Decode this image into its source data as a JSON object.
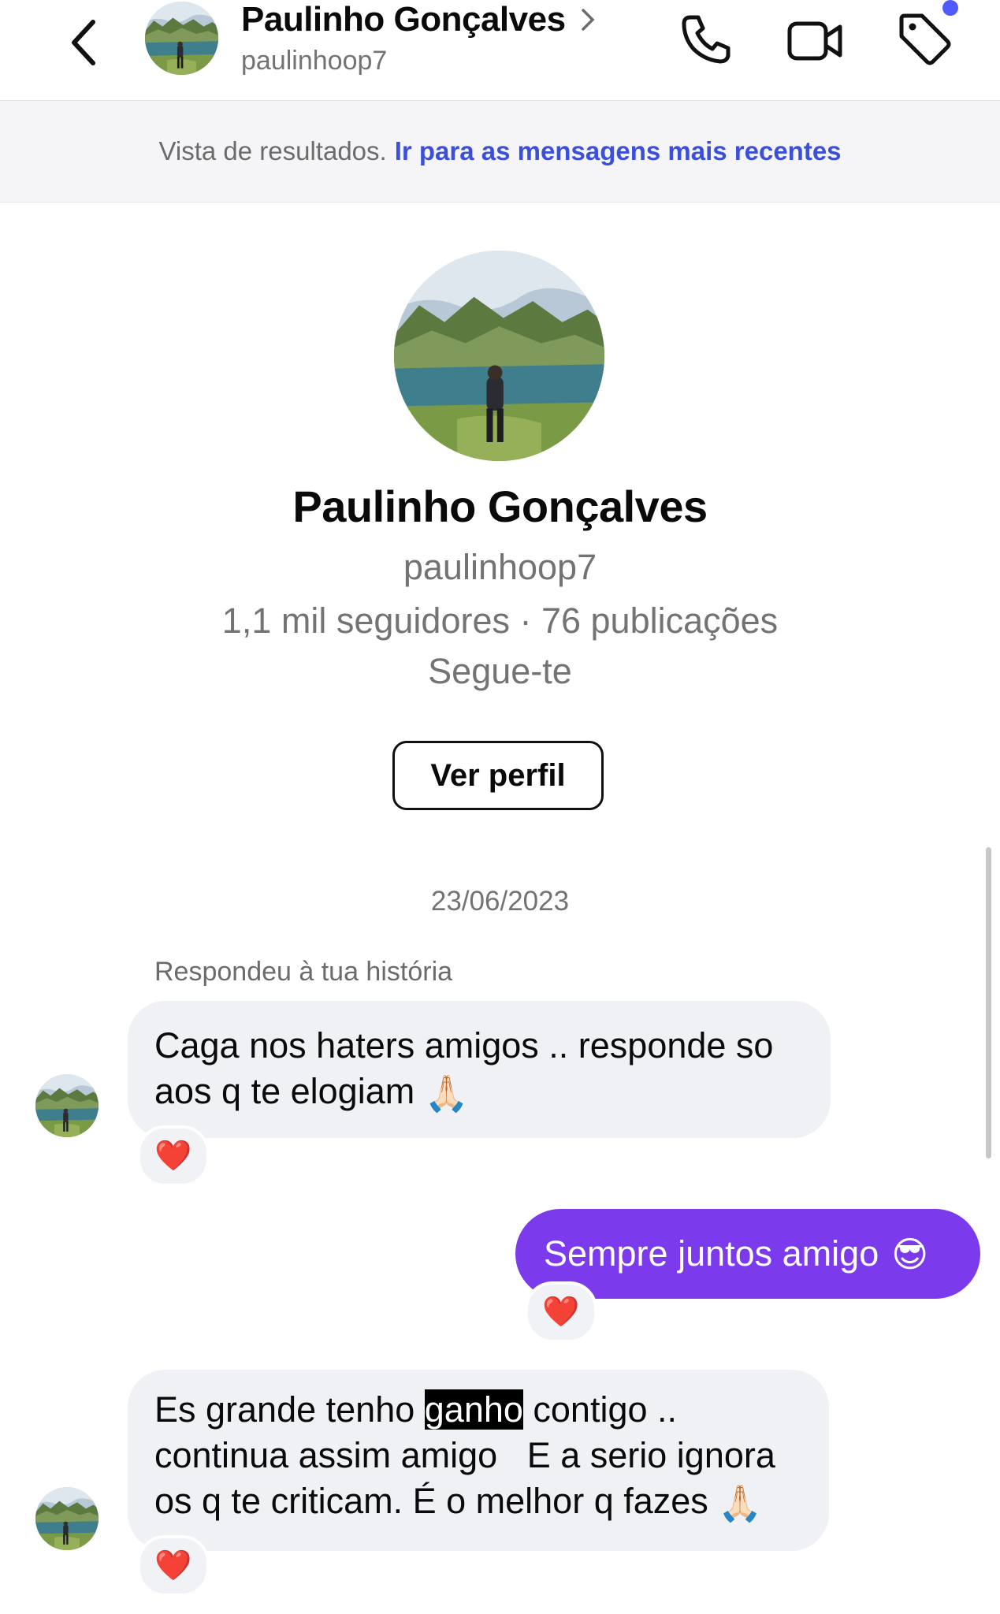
{
  "header": {
    "name": "Paulinho Gonçalves",
    "username": "paulinhoop7",
    "icons": [
      "back-chevron-icon",
      "phone-icon",
      "video-camera-icon",
      "tag-icon"
    ]
  },
  "banner": {
    "text": "Vista de resultados.",
    "link": "Ir para as mensagens mais recentes"
  },
  "profile": {
    "name": "Paulinho Gonçalves",
    "username": "paulinhoop7",
    "stats": "1,1 mil seguidores · 76 publicações",
    "follow_status": "Segue-te",
    "button": "Ver perfil"
  },
  "thread": {
    "date": "23/06/2023",
    "story_reply_label": "Respondeu à tua história",
    "messages": [
      {
        "from": "them",
        "line1": "Caga nos haters amigos .. responde so",
        "line2": "aos q te elogiam",
        "emoji": "🙏🏻",
        "reaction": "❤️"
      },
      {
        "from": "me",
        "text": "Sempre juntos amigo",
        "emoji": "😎",
        "reaction": "❤️"
      },
      {
        "from": "them",
        "line1_a": "Es grande tenho ",
        "line1_hl": "ganho",
        "line1_b": " contigo ..",
        "line2": "continua assim amigo   E a serio ignora",
        "line3": "os q te criticam. É o melhor q fazes",
        "emoji": "🙏🏻",
        "reaction": "❤️"
      }
    ]
  },
  "colors": {
    "outgoing_bubble": "#7c3aed",
    "incoming_bubble": "#eff1f5",
    "link": "#3b4fd8",
    "notification_dot": "#4f5bff"
  }
}
